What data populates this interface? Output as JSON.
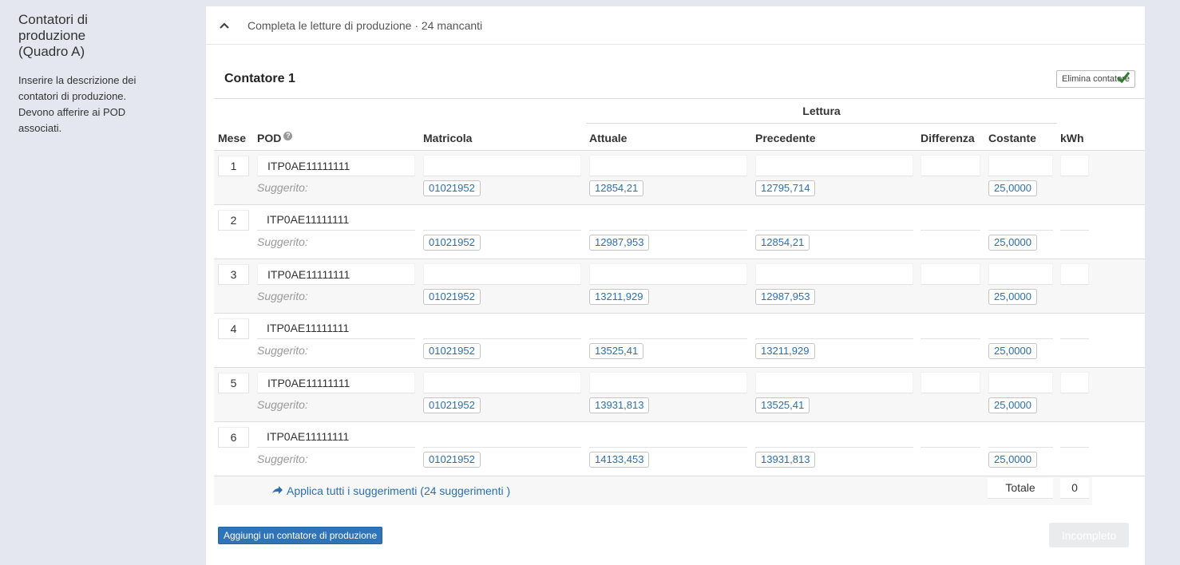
{
  "sidebar": {
    "title": "Contatori di produzione (Quadro A)",
    "description": "Inserire la descrizione dei contatori di produzione. Devono afferire ai POD associati."
  },
  "panel": {
    "header": "Completa le letture di produzione · 24 mancanti",
    "meter_title": "Contatore 1",
    "delete_label": "Elimina contatore"
  },
  "table": {
    "group_header": "Lettura",
    "columns": {
      "mese": "Mese",
      "pod": "POD",
      "matricola": "Matricola",
      "attuale": "Attuale",
      "precedente": "Precedente",
      "differenza": "Differenza",
      "costante": "Costante",
      "kwh": "kWh"
    },
    "suggested_label": "Suggerito:",
    "rows": [
      {
        "mese": "1",
        "pod": "ITP0AE11111111",
        "matricola": "01021952",
        "attuale": "12854,21",
        "precedente": "12795,714",
        "costante": "25,0000"
      },
      {
        "mese": "2",
        "pod": "ITP0AE11111111",
        "matricola": "01021952",
        "attuale": "12987,953",
        "precedente": "12854,21",
        "costante": "25,0000"
      },
      {
        "mese": "3",
        "pod": "ITP0AE11111111",
        "matricola": "01021952",
        "attuale": "13211,929",
        "precedente": "12987,953",
        "costante": "25,0000"
      },
      {
        "mese": "4",
        "pod": "ITP0AE11111111",
        "matricola": "01021952",
        "attuale": "13525,41",
        "precedente": "13211,929",
        "costante": "25,0000"
      },
      {
        "mese": "5",
        "pod": "ITP0AE11111111",
        "matricola": "01021952",
        "attuale": "13931,813",
        "precedente": "13525,41",
        "costante": "25,0000"
      },
      {
        "mese": "6",
        "pod": "ITP0AE11111111",
        "matricola": "01021952",
        "attuale": "14133,453",
        "precedente": "13931,813",
        "costante": "25,0000"
      }
    ],
    "apply_all": "Applica tutti i suggerimenti (24 suggerimenti )",
    "total_label": "Totale",
    "total_value": "0"
  },
  "actions": {
    "add_meter": "Aggiungi un contatore di produzione",
    "incomplete": "Incompleto"
  },
  "colors": {
    "page_bg": "#e4e7ef",
    "link": "#2a6fb5",
    "primary": "#2f73b9",
    "check": "#2e7d32"
  }
}
